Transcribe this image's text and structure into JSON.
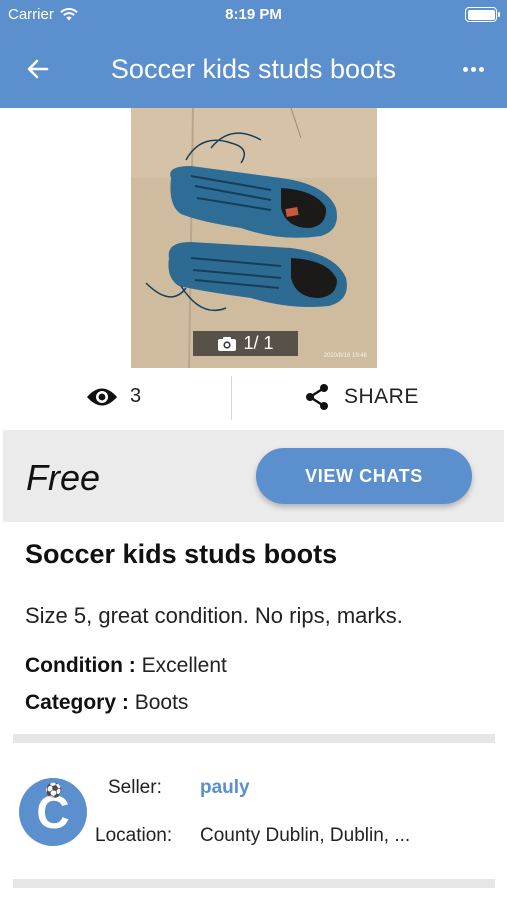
{
  "status_bar": {
    "carrier": "Carrier",
    "time": "8:19 PM"
  },
  "nav": {
    "title": "Soccer kids studs boots",
    "back_icon": "arrow-left-icon",
    "more_icon": "more-horizontal-icon"
  },
  "photo": {
    "counter": "1/ 1",
    "date_stamp": "2020/8/16 19:46"
  },
  "stats": {
    "views": "3",
    "share_label": "SHARE"
  },
  "price": {
    "label": "Free",
    "button_label": "VIEW CHATS"
  },
  "item": {
    "title": "Soccer kids studs boots",
    "description": "Size 5, great condition. No rips, marks.",
    "condition_label": "Condition :",
    "condition_value": "Excellent",
    "category_label": "Category :",
    "category_value": "Boots"
  },
  "seller": {
    "avatar_letter": "C",
    "seller_label": "Seller:",
    "name": "pauly",
    "location_label": "Location:",
    "location": "County Dublin, Dublin, ..."
  },
  "colors": {
    "brand": "#5b8fcd",
    "band": "#ebebeb"
  }
}
